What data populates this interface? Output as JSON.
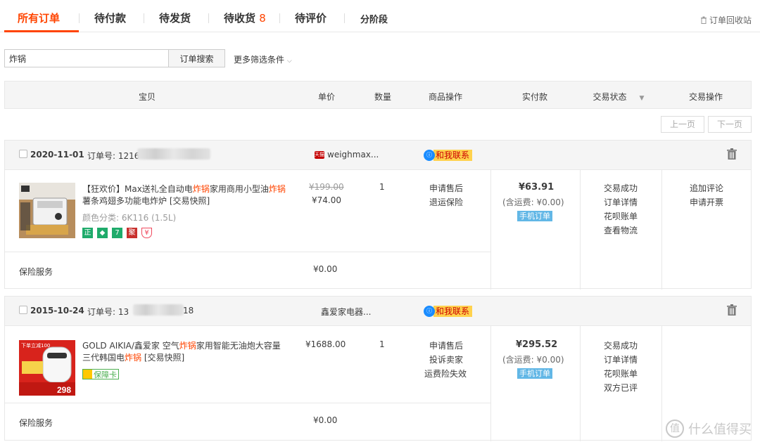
{
  "tabs": [
    {
      "label": "所有订单",
      "count": ""
    },
    {
      "label": "待付款",
      "count": ""
    },
    {
      "label": "待发货",
      "count": ""
    },
    {
      "label": "待收货",
      "count": "8"
    },
    {
      "label": "待评价",
      "count": ""
    },
    {
      "label": "分阶段",
      "count": ""
    }
  ],
  "recycle_bin": "订单回收站",
  "search": {
    "value": "炸锅",
    "button": "订单搜索",
    "more_filters": "更多筛选条件"
  },
  "table_header": {
    "item": "宝贝",
    "unit_price": "单价",
    "quantity": "数量",
    "item_ops": "商品操作",
    "paid": "实付款",
    "status": "交易状态",
    "ops": "交易操作"
  },
  "pager": {
    "prev": "上一页",
    "next": "下一页"
  },
  "contact_label": "和我联系",
  "orders": [
    {
      "date": "2020-11-01",
      "order_no_label": "订单号: 1216",
      "order_no_tail": "",
      "shop": "weighmax...",
      "title_parts": [
        "【狂欢价】Max送礼全自动电",
        "炸锅",
        "家用商用小型油",
        "炸锅",
        "薯条鸡翅多功能电炸炉 [交易快照]"
      ],
      "spec": "颜色分类: 6K116 (1.5L)",
      "original_price": "¥199.00",
      "price": "¥74.00",
      "quantity": "1",
      "item_ops": [
        "申请售后",
        "退运保险"
      ],
      "paid": "¥63.91",
      "shipping": "(含运费: ¥0.00)",
      "mobile_tag": "手机订单",
      "status_links": [
        "交易成功",
        "订单详情",
        "花呗账单",
        "查看物流"
      ],
      "ops": [
        "追加评论",
        "申请开票"
      ],
      "insurance_label": "保险服务",
      "insurance_price": "¥0.00"
    },
    {
      "date": "2015-10-24",
      "order_no_label": "订单号: 13",
      "order_no_tail": "18",
      "shop": "鑫爱家电器...",
      "title_parts": [
        "GOLD AIKIA/鑫爱家 空气",
        "炸锅",
        "家用智能无油炮大容量三代韩国电",
        "炸锅",
        " [交易快照]"
      ],
      "guarantee": "保障卡",
      "price": "¥1688.00",
      "quantity": "1",
      "item_ops": [
        "申请售后",
        "投诉卖家",
        "运费险失效"
      ],
      "paid": "¥295.52",
      "shipping": "(含运费: ¥0.00)",
      "mobile_tag": "手机订单",
      "status_links": [
        "交易成功",
        "订单详情",
        "花呗账单",
        "双方已评"
      ],
      "insurance_label": "保险服务",
      "insurance_price": "¥0.00",
      "promo_text": [
        "下单立减100",
        "298"
      ]
    }
  ],
  "badges": [
    "正",
    "7",
    "聚"
  ],
  "watermark": "什么值得买",
  "colors": {
    "accent": "#ff4400",
    "contact_bg": "#ffd24d",
    "mobile_tag": "#62b7e6"
  }
}
